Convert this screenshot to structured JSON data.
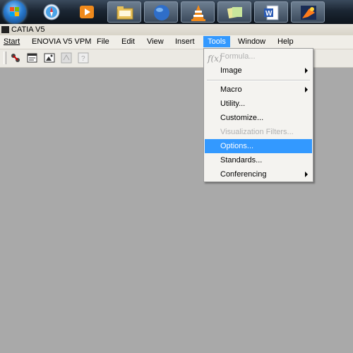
{
  "window": {
    "title": "CATIA V5"
  },
  "taskbar": {
    "start_icon": "windows-orb-icon",
    "items": [
      {
        "icon": "safari-compass-icon"
      },
      {
        "icon": "media-player-icon"
      },
      {
        "icon": "folder-icon"
      },
      {
        "icon": "globe-icon"
      },
      {
        "icon": "vlc-cone-icon"
      },
      {
        "icon": "sticky-notes-icon"
      },
      {
        "icon": "word-document-icon"
      },
      {
        "icon": "catia-app-icon"
      }
    ]
  },
  "menubar": {
    "items": [
      {
        "label": "Start"
      },
      {
        "label": "ENOVIA V5 VPM"
      },
      {
        "label": "File"
      },
      {
        "label": "Edit"
      },
      {
        "label": "View"
      },
      {
        "label": "Insert"
      },
      {
        "label": "Tools"
      },
      {
        "label": "Window"
      },
      {
        "label": "Help"
      }
    ]
  },
  "tools_menu": {
    "items": [
      {
        "label": "Formula...",
        "disabled": true
      },
      {
        "label": "Image",
        "submenu": true
      },
      {
        "label": "Macro",
        "submenu": true
      },
      {
        "label": "Utility..."
      },
      {
        "label": "Customize..."
      },
      {
        "label": "Visualization Filters...",
        "disabled": true
      },
      {
        "label": "Options...",
        "highlighted": true
      },
      {
        "label": "Standards..."
      },
      {
        "label": "Conferencing",
        "submenu": true
      }
    ]
  },
  "colors": {
    "highlight": "#3399ff",
    "workspace": "#a9a9a9"
  }
}
